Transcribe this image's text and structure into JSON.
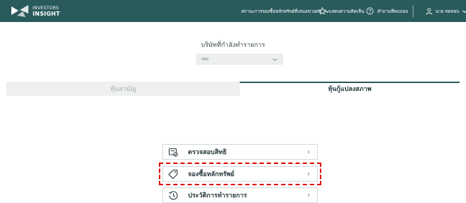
{
  "header": {
    "brand_line1": "INVESTORS",
    "brand_line2": "INSIGHT",
    "nav_issuance_status": "สถานะการจองซื้อหลักทรัพย์ที่เสนอขายต่อ",
    "nav_feedback": "แสดงความคิดเห็น",
    "nav_faq": "คำถามที่พบบ่อย",
    "user_name": "นาย ทดสอบ"
  },
  "company": {
    "label": "บริษัทที่กำลังทำรายการ",
    "selected": "ABC"
  },
  "tabs": [
    {
      "label": "หุ้นสามัญ",
      "active": false
    },
    {
      "label": "หุ้นกู้แปลงสภาพ",
      "active": true
    }
  ],
  "menu": [
    {
      "label": "ตรวจสอบสิทธิ",
      "icon": "verify-rights-icon",
      "highlighted": false
    },
    {
      "label": "จองซื้อหลักทรัพย์",
      "icon": "tag-icon",
      "highlighted": true
    },
    {
      "label": "ประวัติการทำรายการ",
      "icon": "history-clock-icon",
      "highlighted": false
    }
  ],
  "colors": {
    "header_bg": "#2a5b5c",
    "highlight": "#e10000",
    "inactive_tab_bg": "#eeefef"
  }
}
